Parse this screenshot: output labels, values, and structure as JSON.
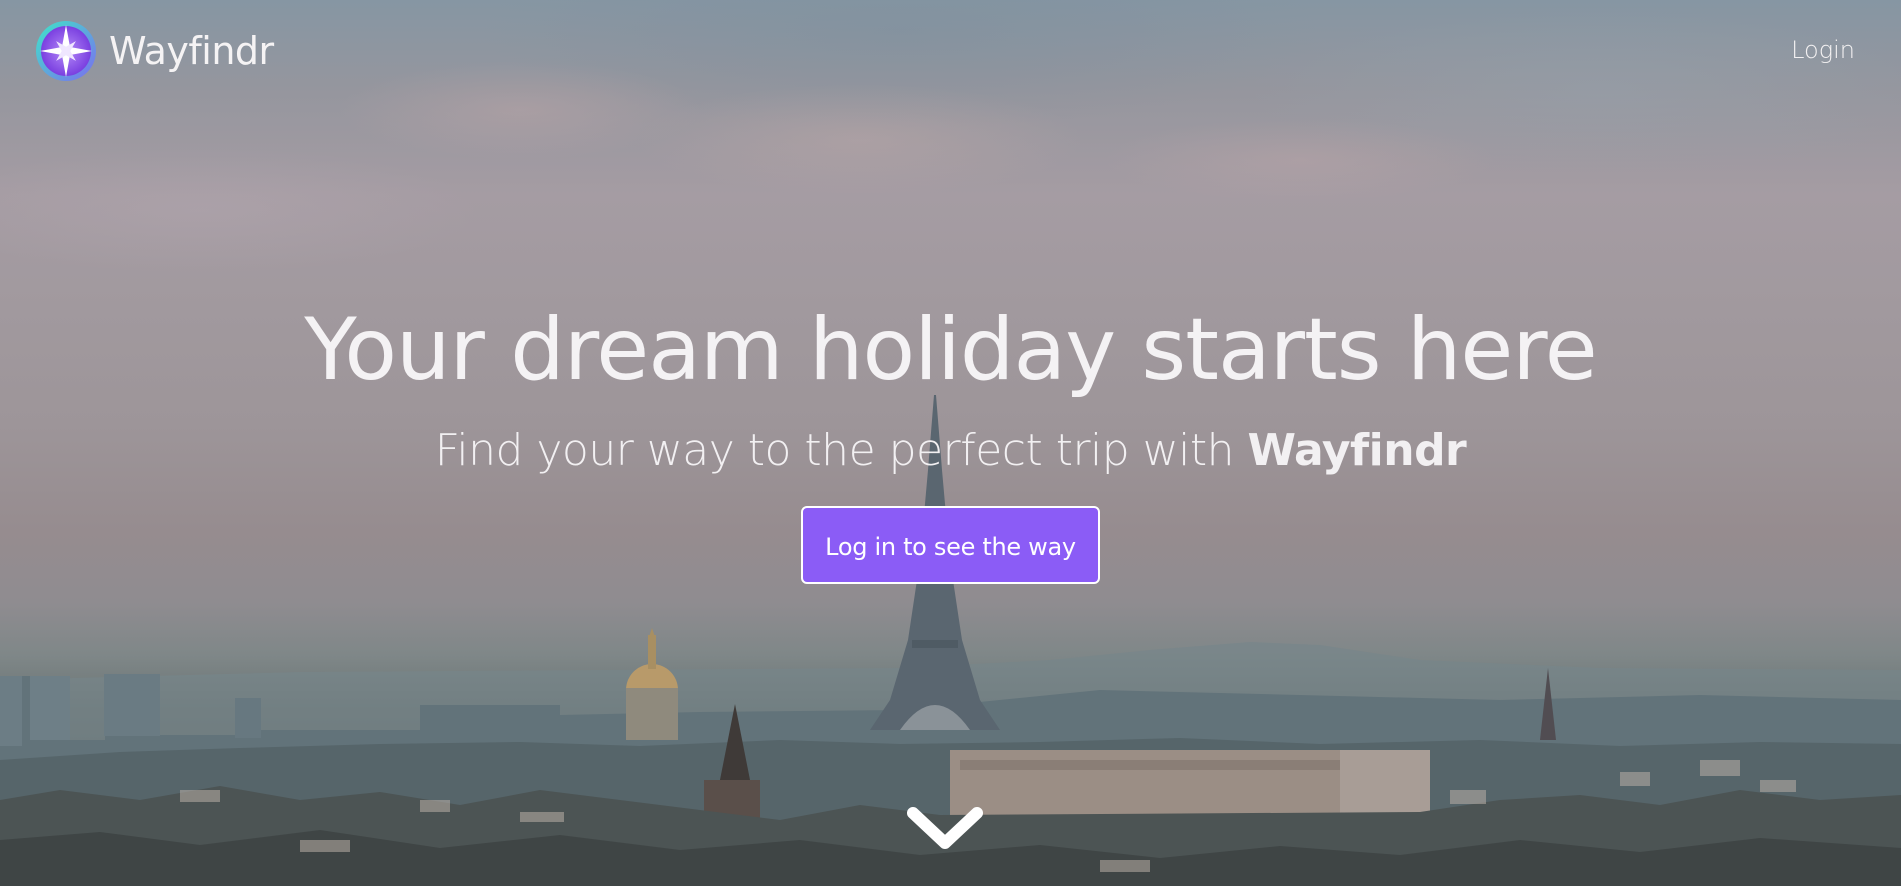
{
  "navbar": {
    "brand_name": "Wayfindr",
    "login_label": "Login"
  },
  "hero": {
    "headline": "Your dream holiday starts here",
    "subheadline_prefix": "Find your way to the perfect trip with ",
    "subheadline_brand": "Wayfindr",
    "cta_label": "Log in to see the way"
  },
  "icons": {
    "logo": "compass-star-icon",
    "scroll": "chevron-down-icon"
  },
  "colors": {
    "accent": "#8b5cf6",
    "text": "#f4f2f4",
    "logo_ring_outer": "#3ee6c8",
    "logo_ring_inner": "#9b5cf0"
  }
}
